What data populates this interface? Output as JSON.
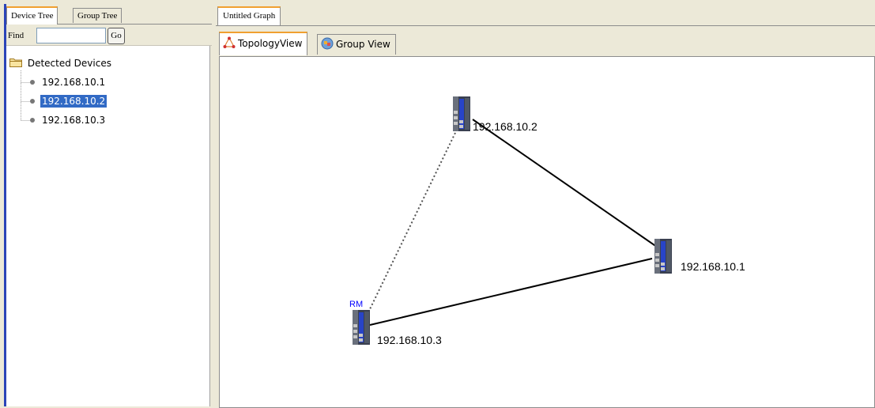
{
  "left_tabs": [
    {
      "label": "Device Tree",
      "active": true
    },
    {
      "label": "Group Tree",
      "active": false
    }
  ],
  "find": {
    "label": "Find",
    "value": "",
    "go_label": "Go"
  },
  "tree": {
    "root_label": "Detected Devices",
    "items": [
      {
        "label": "192.168.10.1",
        "selected": false
      },
      {
        "label": "192.168.10.2",
        "selected": true
      },
      {
        "label": "192.168.10.3",
        "selected": false
      }
    ]
  },
  "graph_tab": {
    "label": "Untitled Graph"
  },
  "view_tabs": [
    {
      "label": "TopologyView",
      "icon": "topology-icon",
      "active": true
    },
    {
      "label": "Group View",
      "icon": "group-view-icon",
      "active": false
    }
  ],
  "topology": {
    "devices": [
      {
        "id": "dev1",
        "label": "192.168.10.1",
        "badge": ""
      },
      {
        "id": "dev2",
        "label": "192.168.10.2",
        "badge": ""
      },
      {
        "id": "dev3",
        "label": "192.168.10.3",
        "badge": "RM"
      }
    ],
    "links": [
      {
        "from": "dev2",
        "to": "dev1",
        "style": "solid"
      },
      {
        "from": "dev1",
        "to": "dev3",
        "style": "solid"
      },
      {
        "from": "dev2",
        "to": "dev3",
        "style": "dotted"
      }
    ]
  },
  "colors": {
    "accent_tab": "#f0a030",
    "selection": "#316ac5",
    "panel_border": "#2b44b8",
    "rm_badge": "#0000ff"
  }
}
